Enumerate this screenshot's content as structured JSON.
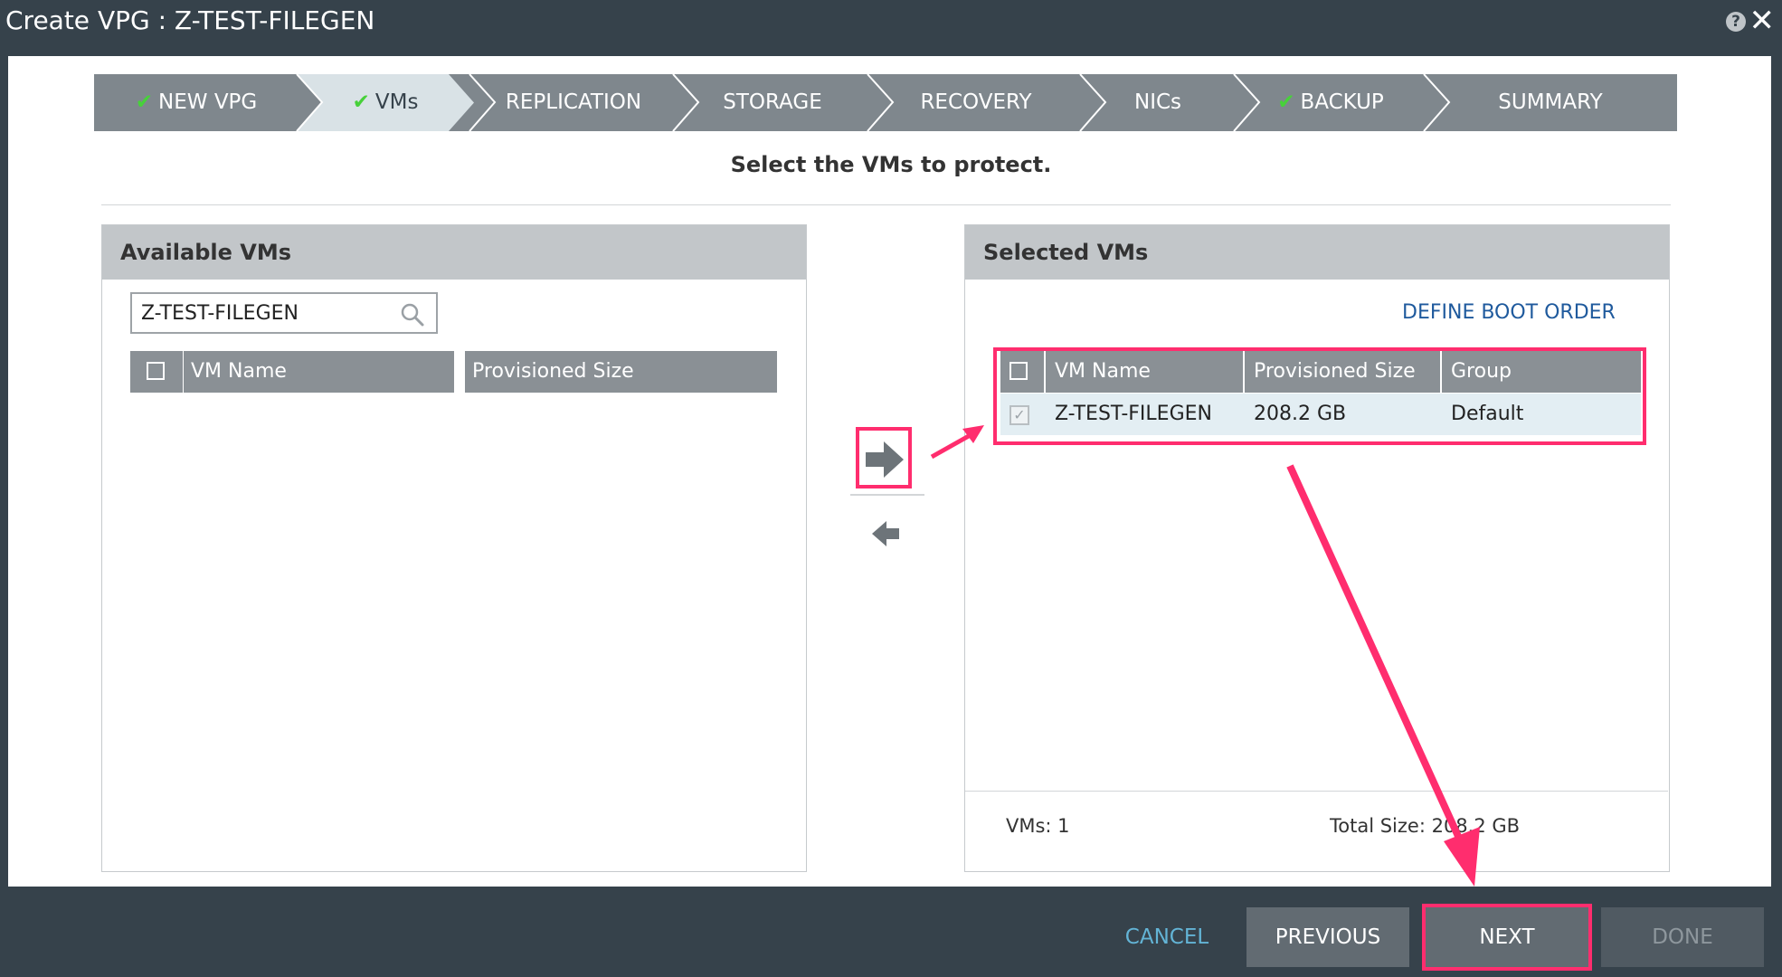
{
  "window": {
    "title": "Create VPG : Z-TEST-FILEGEN",
    "help_icon": "?",
    "close_icon": "✕"
  },
  "wizard": {
    "steps": [
      {
        "label": "NEW VPG",
        "checked": true
      },
      {
        "label": "VMs",
        "checked": true,
        "active": true
      },
      {
        "label": "REPLICATION",
        "checked": false
      },
      {
        "label": "STORAGE",
        "checked": false
      },
      {
        "label": "RECOVERY",
        "checked": false
      },
      {
        "label": "NICs",
        "checked": false
      },
      {
        "label": "BACKUP",
        "checked": true
      },
      {
        "label": "SUMMARY",
        "checked": false
      }
    ],
    "check_glyph": "✔"
  },
  "instruction": "Select the VMs to protect.",
  "available": {
    "title": "Available VMs",
    "search_value": "Z-TEST-FILEGEN",
    "columns": [
      "VM Name",
      "Provisioned Size"
    ]
  },
  "selected": {
    "title": "Selected VMs",
    "define_boot_order": "DEFINE BOOT ORDER",
    "columns": [
      "VM Name",
      "Provisioned Size",
      "Group"
    ],
    "rows": [
      {
        "name": "Z-TEST-FILEGEN",
        "size": "208.2 GB",
        "group": "Default",
        "checked": true
      }
    ],
    "vm_count_label": "VMs: 1",
    "total_size_label": "Total Size: 208.2 GB"
  },
  "buttons": {
    "cancel": "CANCEL",
    "previous": "PREVIOUS",
    "next": "NEXT",
    "done": "DONE"
  },
  "colors": {
    "accent_highlight": "#ff2d6e",
    "check_green": "#47d13a",
    "link_blue": "#1f5a9d"
  }
}
